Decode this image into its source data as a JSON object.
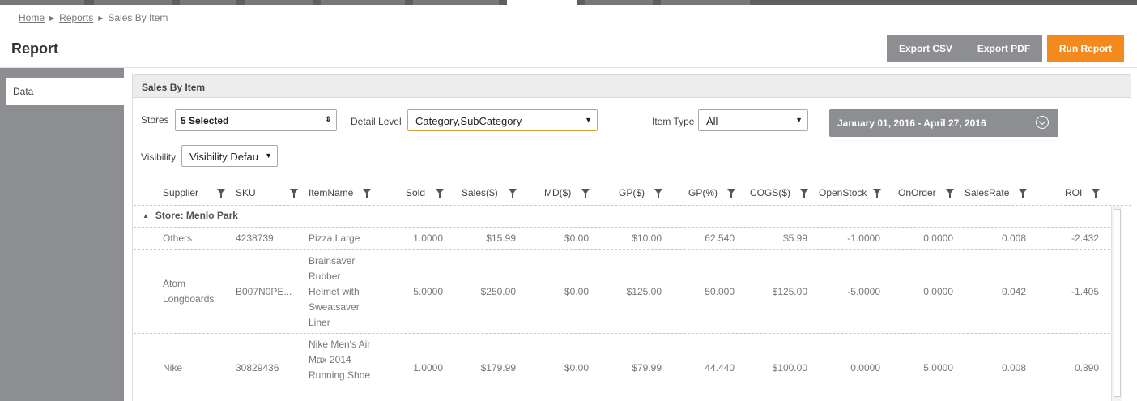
{
  "breadcrumb": {
    "home": "Home",
    "reports": "Reports",
    "current": "Sales By Item"
  },
  "page": {
    "title": "Report"
  },
  "actions": {
    "export_csv": "Export CSV",
    "export_pdf": "Export PDF",
    "run_report": "Run Report"
  },
  "sidebar": {
    "tab_data": "Data"
  },
  "panel": {
    "title": "Sales By Item"
  },
  "filters": {
    "stores_label": "Stores",
    "stores_value": "5 Selected",
    "detail_label": "Detail Level",
    "detail_value": "Category,SubCategory",
    "itemtype_label": "Item Type",
    "itemtype_value": "All",
    "visibility_label": "Visibility",
    "visibility_value": "Visibility Defau",
    "date_range": "January 01, 2016 - April 27, 2016"
  },
  "colors": {
    "accent": "#f48a1e",
    "button_gray": "#8c8e92",
    "sidebar": "#8c8e92"
  },
  "table": {
    "columns": [
      "Supplier",
      "SKU",
      "ItemName",
      "Sold",
      "Sales($)",
      "MD($)",
      "GP($)",
      "GP(%)",
      "COGS($)",
      "OpenStock",
      "OnOrder",
      "SalesRate",
      "ROI"
    ],
    "group": "Store: Menlo Park",
    "rows": [
      {
        "supplier": "Others",
        "sku": "4238739",
        "item": "Pizza Large",
        "sold": "1.0000",
        "sales": "$15.99",
        "md": "$0.00",
        "gp": "$10.00",
        "gpp": "62.540",
        "cogs": "$5.99",
        "openstock": "-1.0000",
        "onorder": "0.0000",
        "salesrate": "0.008",
        "roi": "-2.432"
      },
      {
        "supplier": "Atom Longboards",
        "sku": "B007N0PE...",
        "item": "Brainsaver Rubber Helmet with Sweatsaver Liner",
        "sold": "5.0000",
        "sales": "$250.00",
        "md": "$0.00",
        "gp": "$125.00",
        "gpp": "50.000",
        "cogs": "$125.00",
        "openstock": "-5.0000",
        "onorder": "0.0000",
        "salesrate": "0.042",
        "roi": "-1.405"
      },
      {
        "supplier": "Nike",
        "sku": "30829436",
        "item": "Nike Men's Air Max 2014 Running Shoe",
        "sold": "1.0000",
        "sales": "$179.99",
        "md": "$0.00",
        "gp": "$79.99",
        "gpp": "44.440",
        "cogs": "$100.00",
        "openstock": "0.0000",
        "onorder": "5.0000",
        "salesrate": "0.008",
        "roi": "0.890"
      }
    ]
  }
}
